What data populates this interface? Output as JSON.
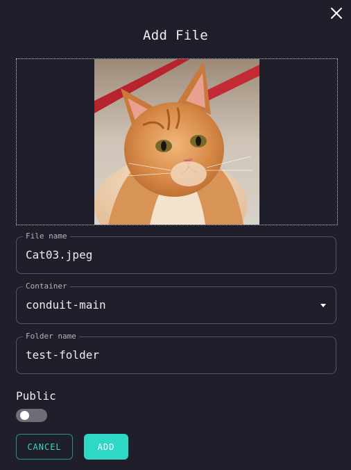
{
  "dialog": {
    "title": "Add File",
    "close_icon": "close-icon"
  },
  "preview": {
    "image": "orange-tabby-cat-photo"
  },
  "fields": {
    "file_name": {
      "label": "File name",
      "value": "Cat03.jpeg"
    },
    "container": {
      "label": "Container",
      "value": "conduit-main",
      "icon": "caret-down-icon"
    },
    "folder_name": {
      "label": "Folder name",
      "value": "test-folder"
    }
  },
  "public": {
    "label": "Public",
    "enabled": false
  },
  "actions": {
    "cancel_label": "CANCEL",
    "add_label": "ADD"
  },
  "colors": {
    "background": "#1f1f2b",
    "accent": "#2fd8c4",
    "border": "#55556a"
  }
}
